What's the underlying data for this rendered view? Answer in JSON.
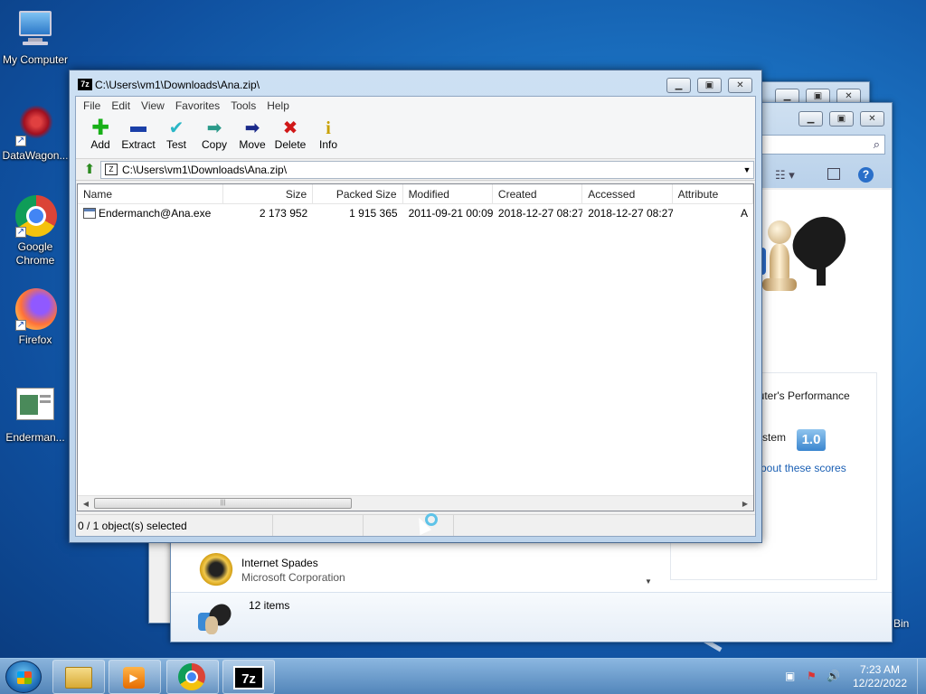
{
  "desktop": {
    "icons": [
      {
        "label": "My Computer",
        "icon": "computer-icon"
      },
      {
        "label": "DataWagon...",
        "icon": "datawagon-icon"
      },
      {
        "label": "Google Chrome",
        "icon": "chrome-icon"
      },
      {
        "label": "Firefox",
        "icon": "firefox-icon"
      },
      {
        "label": "Enderman...",
        "icon": "enderman-exe-icon"
      }
    ],
    "recycle_partial": "Bin"
  },
  "bg_games_window": {
    "perf_line1": "puter's Performance",
    "perf_line2": "ystem",
    "score": "1.0",
    "link": "bout these scores",
    "list_item": {
      "name": "Internet Spades",
      "publisher": "Microsoft Corporation"
    },
    "count": "12 items"
  },
  "window": {
    "title": "C:\\Users\\vm1\\Downloads\\Ana.zip\\",
    "app_badge": "7z",
    "menu": [
      "File",
      "Edit",
      "View",
      "Favorites",
      "Tools",
      "Help"
    ],
    "toolbar": [
      {
        "label": "Add",
        "icon": "plus-icon",
        "color": "#18b018"
      },
      {
        "label": "Extract",
        "icon": "minus-icon",
        "color": "#1a3fa8"
      },
      {
        "label": "Test",
        "icon": "checkmark-icon",
        "color": "#2ab6c6"
      },
      {
        "label": "Copy",
        "icon": "copy-arrow-icon",
        "color": "#2a9a8a"
      },
      {
        "label": "Move",
        "icon": "move-arrow-icon",
        "color": "#1a2a8a"
      },
      {
        "label": "Delete",
        "icon": "delete-x-icon",
        "color": "#d01818"
      },
      {
        "label": "Info",
        "icon": "info-icon",
        "color": "#c8a000"
      }
    ],
    "address": "C:\\Users\\vm1\\Downloads\\Ana.zip\\",
    "columns": [
      "Name",
      "Size",
      "Packed Size",
      "Modified",
      "Created",
      "Accessed",
      "Attribute"
    ],
    "rows": [
      {
        "name": "Endermanch@Ana.exe",
        "size": "2 173 952",
        "packed": "1 915 365",
        "modified": "2011-09-21 00:09",
        "created": "2018-12-27 08:27",
        "accessed": "2018-12-27 08:27",
        "attr": "A"
      }
    ],
    "status": "0 / 1 object(s) selected"
  },
  "taskbar": {
    "time": "7:23 AM",
    "date": "12/22/2022",
    "items": [
      "explorer",
      "media-player",
      "chrome",
      "7-zip"
    ]
  }
}
